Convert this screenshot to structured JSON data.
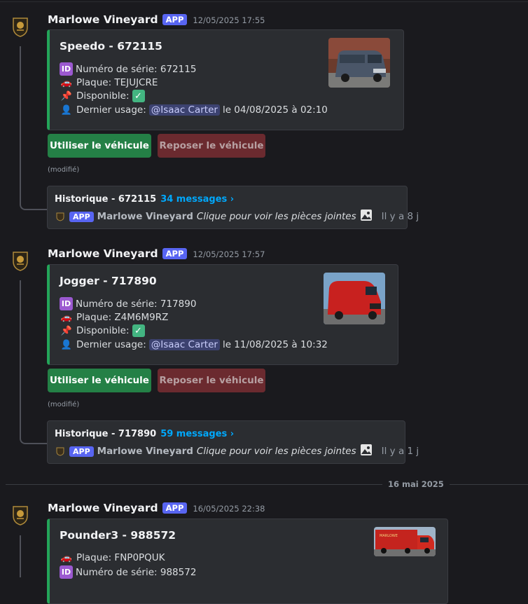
{
  "date_divider": "16 mai 2025",
  "messages": [
    {
      "author": "Marlowe Vineyard",
      "badge": "APP",
      "timestamp": "12/05/2025 17:55",
      "embed": {
        "title": "Speedo - 672115",
        "fields": [
          {
            "icon": "id-icon",
            "text": "Numéro de série: 672115"
          },
          {
            "icon": "car-icon",
            "text": "Plaque: TEJUJCRE"
          },
          {
            "icon": "pushpin-icon",
            "text": "Disponible:"
          },
          {
            "icon": "user-icon",
            "text": "Dernier usage:",
            "mention": "@Isaac Carter",
            "after": "le 04/08/2025 à 02:10"
          }
        ],
        "thumbnail": "blue-van"
      },
      "buttons": {
        "use": "Utiliser le véhicule",
        "return": "Reposer le véhicule"
      },
      "edited": "(modifié)",
      "thread": {
        "title": "Historique - 672115",
        "count": "34 messages ›",
        "last_author": "Marlowe Vineyard",
        "badge": "APP",
        "preview": "Clique pour voir les pièces jointes",
        "ago": "Il y a 8 j"
      }
    },
    {
      "author": "Marlowe Vineyard",
      "badge": "APP",
      "timestamp": "12/05/2025 17:57",
      "embed": {
        "title": "Jogger - 717890",
        "fields": [
          {
            "icon": "id-icon",
            "text": "Numéro de série: 717890"
          },
          {
            "icon": "car-icon",
            "text": "Plaque: Z4M6M9RZ"
          },
          {
            "icon": "pushpin-icon",
            "text": "Disponible:"
          },
          {
            "icon": "user-icon",
            "text": "Dernier usage:",
            "mention": "@Isaac Carter",
            "after": "le 11/08/2025 à 10:32"
          }
        ],
        "thumbnail": "red-van"
      },
      "buttons": {
        "use": "Utiliser le véhicule",
        "return": "Reposer le véhicule"
      },
      "edited": "(modifié)",
      "thread": {
        "title": "Historique - 717890",
        "count": "59 messages ›",
        "last_author": "Marlowe Vineyard",
        "badge": "APP",
        "preview": "Clique pour voir les pièces jointes",
        "ago": "Il y a 1 j"
      }
    },
    {
      "author": "Marlowe Vineyard",
      "badge": "APP",
      "timestamp": "16/05/2025 22:38",
      "embed": {
        "title": "Pounder3 - 988572",
        "fields": [
          {
            "icon": "car-icon",
            "text": "Plaque: FNP0PQUK"
          },
          {
            "icon": "id-icon",
            "text": "Numéro de série: 988572"
          }
        ],
        "thumbnail": "red-truck"
      }
    }
  ]
}
